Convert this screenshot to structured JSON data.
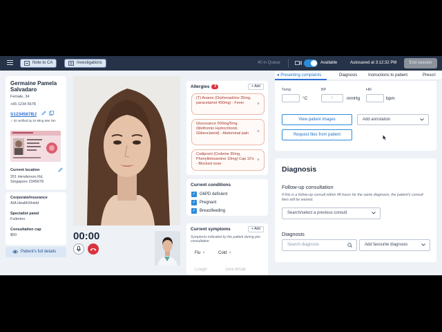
{
  "topbar": {
    "note_button": "Note to CA",
    "investigations_button": "Investigations",
    "queue": "40 in Queue",
    "availability": "Available",
    "autosave": "Autosaved at 3:12:32 PM",
    "end_session": "End session"
  },
  "patient": {
    "name": "Germaine Pamela Salvadaro",
    "gender_age": "Female, 34",
    "phone": "+65 1234 5678",
    "id_number": "S1234567BJ",
    "id_verified": "ID verified by Dr Ming Wei Tan",
    "location_label": "Current location",
    "location": "201 Henderson Rd, Singapore 2345678",
    "insurance_label": "Corporate/insurance",
    "insurance": "AIA HealthShield",
    "panel_label": "Specialist panel",
    "panel": "Fullerton",
    "cap_label": "Consultation cap",
    "cap": "$50",
    "full_details_button": "Patient's full details"
  },
  "video": {
    "timer": "00:00"
  },
  "allergies": {
    "title": "Allergies",
    "count": "3",
    "add_label": "+ Add",
    "items": [
      "(T) Anarex (Orphenadrine 35mg, paracetamol 450mg) - Fever",
      "Glucovance 500mg/5mg (Metformin Hydrochlorid, Glibenclamid) - Abdominal pain",
      "Codipront (Codeine 30mg, Phenyltoloxamine 10mg) Cap 10's - Blocked nose"
    ]
  },
  "conditions": {
    "title": "Current conditions",
    "items": [
      "G6PD deficient",
      "Pregnant",
      "Breastfeeding"
    ]
  },
  "symptoms": {
    "title": "Current symptoms",
    "add_label": "+ Add",
    "description": "Symptoms indicated by the patient during pre-consultation",
    "chips": [
      "Flu",
      "Cold",
      "Cough",
      "Sore throat"
    ]
  },
  "tabs": [
    "Presenting complaints",
    "Diagnosis",
    "Instructions to patient",
    "Prescri"
  ],
  "vitals": {
    "temp_label": "Temp",
    "temp_unit": "°C",
    "bp_label": "BP",
    "bp_sep": "/",
    "bp_unit": "mmHg",
    "hr_label": "HR",
    "hr_unit": "bpm",
    "view_images": "View patient images",
    "add_annotation": "Add annotation",
    "request_files": "Request files from patient"
  },
  "diagnosis": {
    "title": "Diagnosis",
    "followup_title": "Follow-up consultation",
    "followup_note": "If this is a follow-up consult within 48 hours for the same diagnosis, the patient's consult fees will be waived.",
    "followup_select": "Search/select a previous consult",
    "diag_label": "Diagnosis",
    "search_placeholder": "Search diagnosis",
    "favourite": "Add favourite diagnosis"
  },
  "colors": {
    "topbar": "#253247",
    "accent": "#2b8bd9",
    "end_call": "#d9333f",
    "allergy_text": "#a6362a"
  }
}
